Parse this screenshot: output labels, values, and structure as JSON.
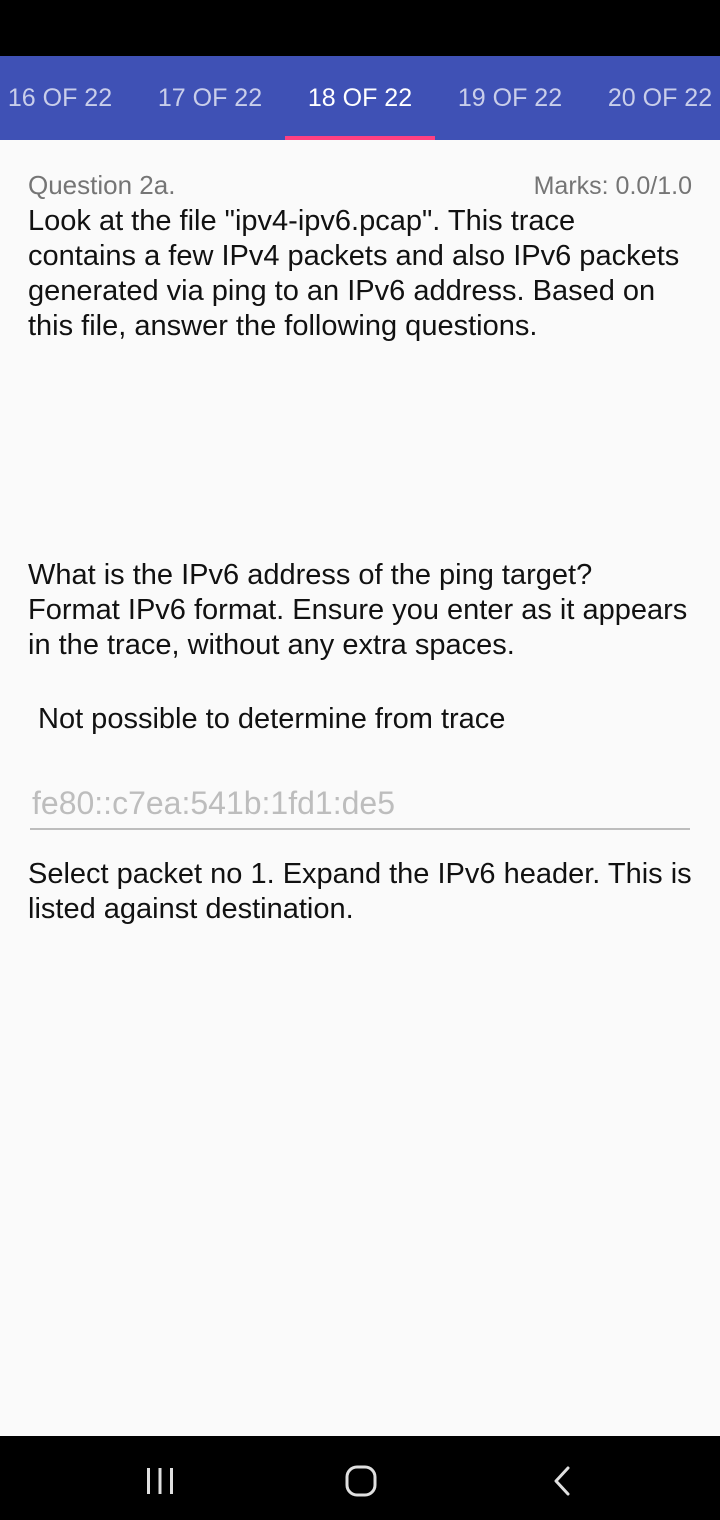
{
  "tabs": [
    {
      "label": "16 OF 22",
      "active": false
    },
    {
      "label": "17 OF 22",
      "active": false
    },
    {
      "label": "18 OF 22",
      "active": true
    },
    {
      "label": "19 OF 22",
      "active": false
    },
    {
      "label": "20 OF 22",
      "active": false
    }
  ],
  "question": {
    "number": "Question 2a.",
    "marks": "Marks: 0.0/1.0",
    "intro": "Look at the file \"ipv4-ipv6.pcap\". This trace contains a few IPv4 packets and also IPv6 packets generated via ping to an IPv6 address. Based on this file, answer the following questions.",
    "prompt": "What is the IPv6 address of the ping target? Format IPv6 format. Ensure you enter as it appears in the trace, without any extra spaces.",
    "option_text": "Not possible to determine from trace",
    "answer_placeholder": "fe80::c7ea:541b:1fd1:de5",
    "feedback": "Select packet no 1. Expand the IPv6 header. This is listed against destination."
  },
  "nav_icons": [
    "recent-apps-icon",
    "home-icon",
    "back-icon"
  ],
  "colors": {
    "tab_bar": "#3f51b5",
    "tab_indicator": "#ff4081",
    "background": "#fafafa",
    "system_bars": "#000000"
  }
}
